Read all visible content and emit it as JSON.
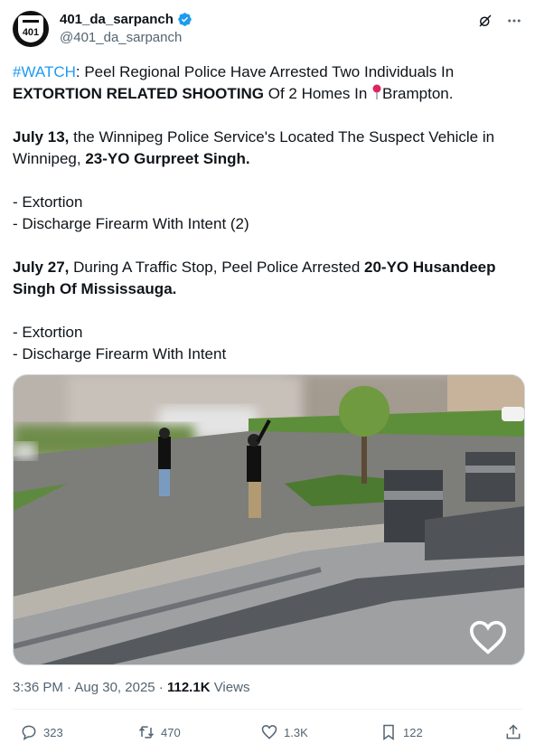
{
  "author": {
    "display_name": "401_da_sarpanch",
    "handle": "@401_da_sarpanch",
    "avatar_text": "401",
    "verified": true,
    "verified_color": "#1d9bf0"
  },
  "header_icons": [
    "grok-icon",
    "more-icon"
  ],
  "tweet": {
    "hashtag": "#WATCH",
    "line1_rest": ": Peel Regional Police Have Arrested Two Individuals In",
    "line2_bold": "EXTORTION RELATED SHOOTING",
    "line2_rest": " Of 2 Homes In ",
    "line2_place": "Brampton.",
    "p2_bold": "July 13,",
    "p2_text": " the Winnipeg Police Service's Located The Suspect Vehicle in Winnipeg, ",
    "p2_bold2": "23-YO Gurpreet Singh.",
    "p3_line1": "- Extortion",
    "p3_line2": "- Discharge Firearm With Intent (2)",
    "p4_bold": "July 27,",
    "p4_text": " During A Traffic Stop, Peel Police Arrested ",
    "p4_bold2": "20-YO Husandeep Singh Of Mississauga.",
    "p5_line1": "- Extortion",
    "p5_line2": "- Discharge Firearm With Intent",
    "hashtag_color": "#1d9bf0"
  },
  "meta": {
    "time": "3:36 PM",
    "separator": " · ",
    "date": "Aug 30, 2025",
    "views_count": "112.1K",
    "views_label": " Views"
  },
  "actions": {
    "replies": "323",
    "reposts": "470",
    "likes": "1.3K",
    "bookmarks": "122"
  },
  "colors": {
    "text": "#0f1419",
    "secondary": "#536471",
    "divider": "#eff3f4"
  }
}
